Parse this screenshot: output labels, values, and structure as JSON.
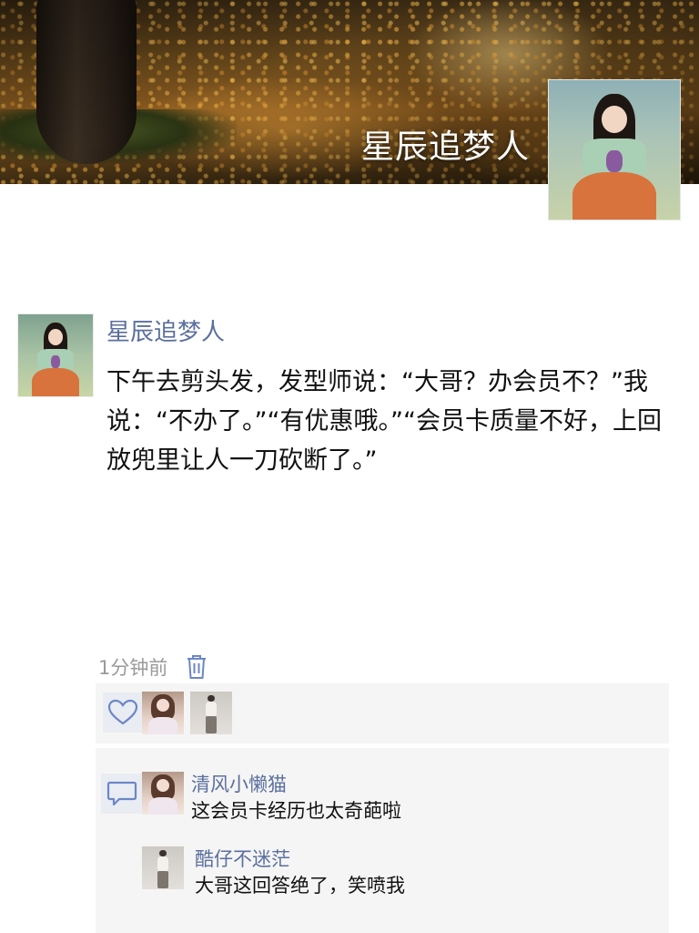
{
  "cover": {
    "title": "星辰追梦人"
  },
  "post": {
    "author": "星辰追梦人",
    "text": "下午去剪头发，发型师说：“大哥？办会员不？”我说：“不办了。”“有优惠哦。”“会员卡质量不好，上回放兜里让人一刀砍断了。”",
    "time": "1分钟前"
  },
  "likes": {
    "icon": "heart-icon",
    "avatars": [
      "liker-avatar-1",
      "liker-avatar-2"
    ]
  },
  "comments": [
    {
      "author": "清风小懒猫",
      "text": "这会员卡经历也太奇葩啦"
    },
    {
      "author": "酷仔不迷茫",
      "text": "大哥这回答绝了，笑喷我"
    }
  ],
  "colors": {
    "link_blue": "#5b6f9f",
    "time_gray": "#9a9a9a",
    "panel_bg": "#f5f5f5",
    "icon_blue": "#6b86c9"
  }
}
